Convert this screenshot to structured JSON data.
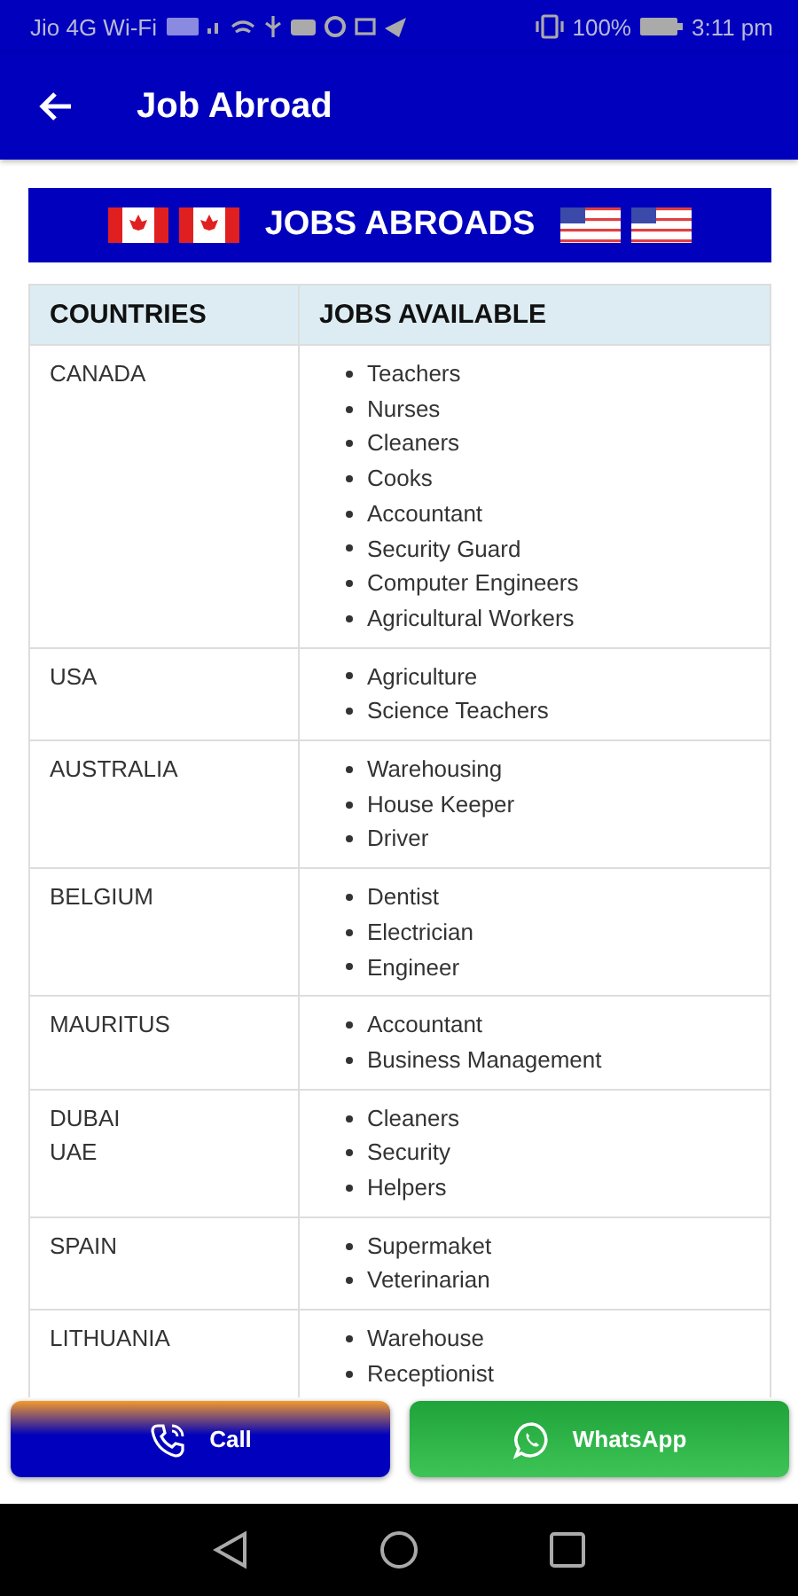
{
  "status_bar": {
    "carrier": "Jio 4G Wi-Fi",
    "battery": "100%",
    "time": "3:11 pm"
  },
  "app_bar": {
    "title": "Job Abroad"
  },
  "banner": {
    "title": "JOBS ABROADS"
  },
  "table": {
    "columns": [
      "COUNTRIES",
      "JOBS AVAILABLE"
    ],
    "rows": [
      {
        "country": [
          "CANADA"
        ],
        "jobs": [
          "Teachers",
          "Nurses",
          "Cleaners",
          "Cooks",
          "Accountant",
          "Security Guard",
          "Computer Engineers",
          "Agricultural Workers"
        ]
      },
      {
        "country": [
          "USA"
        ],
        "jobs": [
          "Agriculture",
          "Science Teachers"
        ]
      },
      {
        "country": [
          "AUSTRALIA"
        ],
        "jobs": [
          "Warehousing",
          "House Keeper",
          "Driver"
        ]
      },
      {
        "country": [
          "BELGIUM"
        ],
        "jobs": [
          "Dentist",
          "Electrician",
          "Engineer"
        ]
      },
      {
        "country": [
          "MAURITUS"
        ],
        "jobs": [
          "Accountant",
          "Business Management"
        ]
      },
      {
        "country": [
          "DUBAI",
          "UAE"
        ],
        "jobs": [
          "Cleaners",
          "Security",
          "Helpers"
        ]
      },
      {
        "country": [
          "SPAIN"
        ],
        "jobs": [
          "Supermaket",
          "Veterinarian"
        ]
      },
      {
        "country": [
          "LITHUANIA"
        ],
        "jobs": [
          "Warehouse",
          "Receptionist"
        ]
      }
    ]
  },
  "buttons": [
    {
      "kind": "call",
      "label": "Call"
    },
    {
      "kind": "whatsapp",
      "label": "WhatsApp"
    }
  ]
}
